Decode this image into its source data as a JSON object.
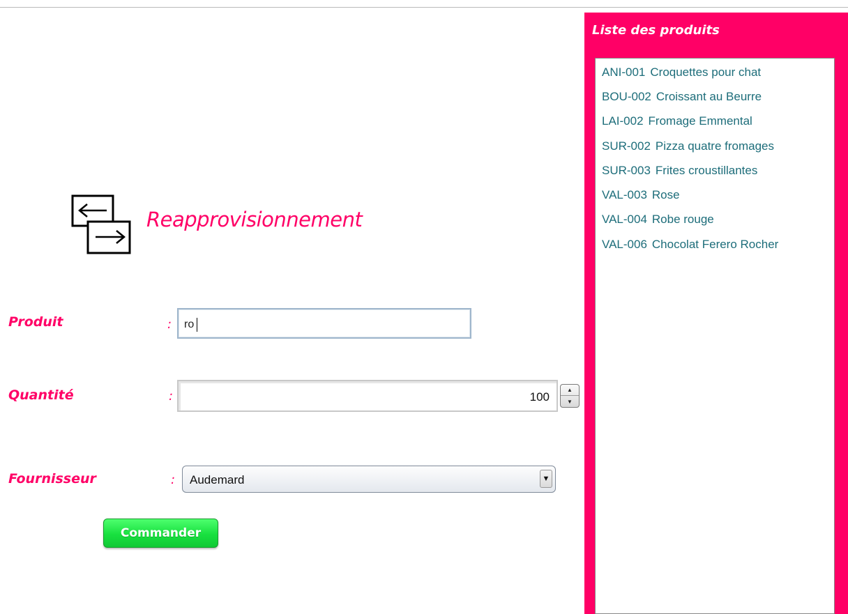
{
  "header": {
    "title": "Reapprovisionnement",
    "logo_icon": "transfer-arrows-icon"
  },
  "form": {
    "produit_label": "Produit",
    "quantite_label": "Quantité",
    "fournisseur_label": "Fournisseur",
    "colon": ":",
    "produit_value": "ro",
    "quantite_value": "100",
    "fournisseur_value": "Audemard",
    "submit_label": "Commander"
  },
  "sidebar": {
    "title": "Liste des produits",
    "items": [
      {
        "code": "ANI-001",
        "name": "Croquettes pour chat"
      },
      {
        "code": "BOU-002",
        "name": "Croissant au Beurre"
      },
      {
        "code": "LAI-002",
        "name": "Fromage Emmental"
      },
      {
        "code": "SUR-002",
        "name": "Pizza quatre fromages"
      },
      {
        "code": "SUR-003",
        "name": "Frites croustillantes"
      },
      {
        "code": "VAL-003",
        "name": "Rose"
      },
      {
        "code": "VAL-004",
        "name": "Robe rouge"
      },
      {
        "code": "VAL-006",
        "name": "Chocolat Ferero Rocher"
      }
    ]
  },
  "colors": {
    "accent": "#ff0066",
    "button_green": "#18e03f",
    "list_text": "#1d6d7a"
  }
}
